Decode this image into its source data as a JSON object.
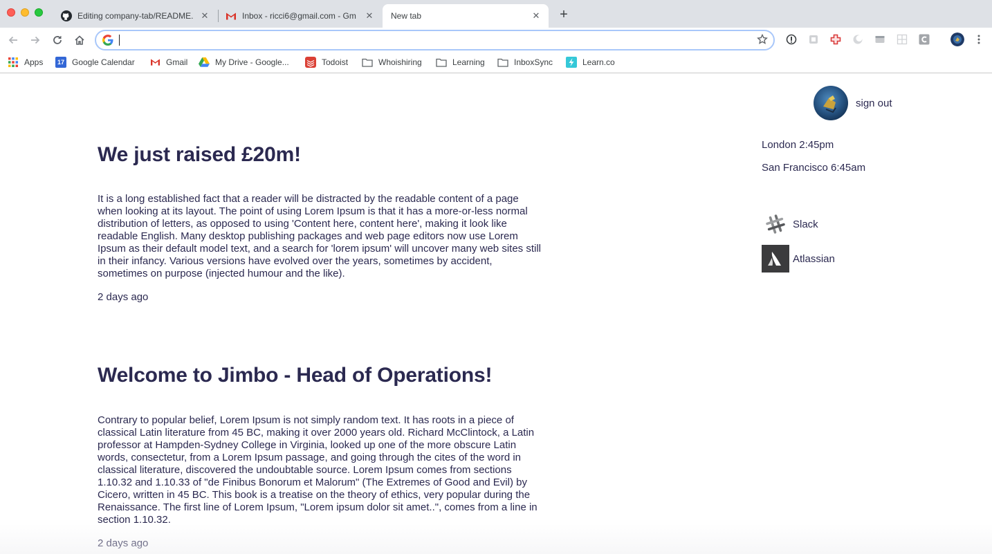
{
  "browser": {
    "tabs": [
      {
        "title": "Editing company-tab/README.",
        "favicon": "github-icon"
      },
      {
        "title": "Inbox - ricci6@gmail.com - Gm",
        "favicon": "gmail-icon"
      },
      {
        "title": "New tab",
        "favicon": "none"
      }
    ],
    "active_tab_index": 2,
    "new_tab_label": "+",
    "close_glyph": "✕",
    "address_bar": {
      "value": "",
      "placeholder": ""
    },
    "bookmarks": [
      {
        "label": "Apps",
        "icon": "apps-grid-icon"
      },
      {
        "label": "Google Calendar",
        "icon": "calendar-icon"
      },
      {
        "label": "Gmail",
        "icon": "gmail-icon"
      },
      {
        "label": "My Drive - Google...",
        "icon": "drive-icon"
      },
      {
        "label": "Todoist",
        "icon": "todoist-icon"
      },
      {
        "label": "Whoishiring",
        "icon": "folder-icon"
      },
      {
        "label": "Learning",
        "icon": "folder-icon"
      },
      {
        "label": "InboxSync",
        "icon": "folder-icon"
      },
      {
        "label": "Learn.co",
        "icon": "learnco-icon"
      }
    ],
    "calendar_badge": "17"
  },
  "page": {
    "posts": [
      {
        "title": "We just raised £20m!",
        "body": "It is a long established fact that a reader will be distracted by the readable content of a page when looking at its layout. The point of using Lorem Ipsum is that it has a more-or-less normal distribution of letters, as opposed to using 'Content here, content here', making it look like readable English. Many desktop publishing packages and web page editors now use Lorem Ipsum as their default model text, and a search for 'lorem ipsum' will uncover many web sites still in their infancy. Various versions have evolved over the years, sometimes by accident, sometimes on purpose (injected humour and the like).",
        "time": "2 days ago"
      },
      {
        "title": "Welcome to Jimbo - Head of Operations!",
        "body": "Contrary to popular belief, Lorem Ipsum is not simply random text. It has roots in a piece of classical Latin literature from 45 BC, making it over 2000 years old. Richard McClintock, a Latin professor at Hampden-Sydney College in Virginia, looked up one of the more obscure Latin words, consectetur, from a Lorem Ipsum passage, and going through the cites of the word in classical literature, discovered the undoubtable source. Lorem Ipsum comes from sections 1.10.32 and 1.10.33 of \"de Finibus Bonorum et Malorum\" (The Extremes of Good and Evil) by Cicero, written in 45 BC. This book is a treatise on the theory of ethics, very popular during the Renaissance. The first line of Lorem Ipsum, \"Lorem ipsum dolor sit amet..\", comes from a line in section 1.10.32.",
        "time": "2 days ago"
      }
    ],
    "sidebar": {
      "signout_label": "sign out",
      "clocks": [
        "London 2:45pm",
        "San Francisco 6:45am"
      ],
      "apps": [
        {
          "label": "Slack",
          "icon": "slack-icon"
        },
        {
          "label": "Atlassian",
          "icon": "atlassian-icon"
        }
      ]
    }
  },
  "colors": {
    "text": "#2b2950",
    "chrome_bg": "#dee1e6",
    "omnibox_focus": "#a8c7fa"
  }
}
